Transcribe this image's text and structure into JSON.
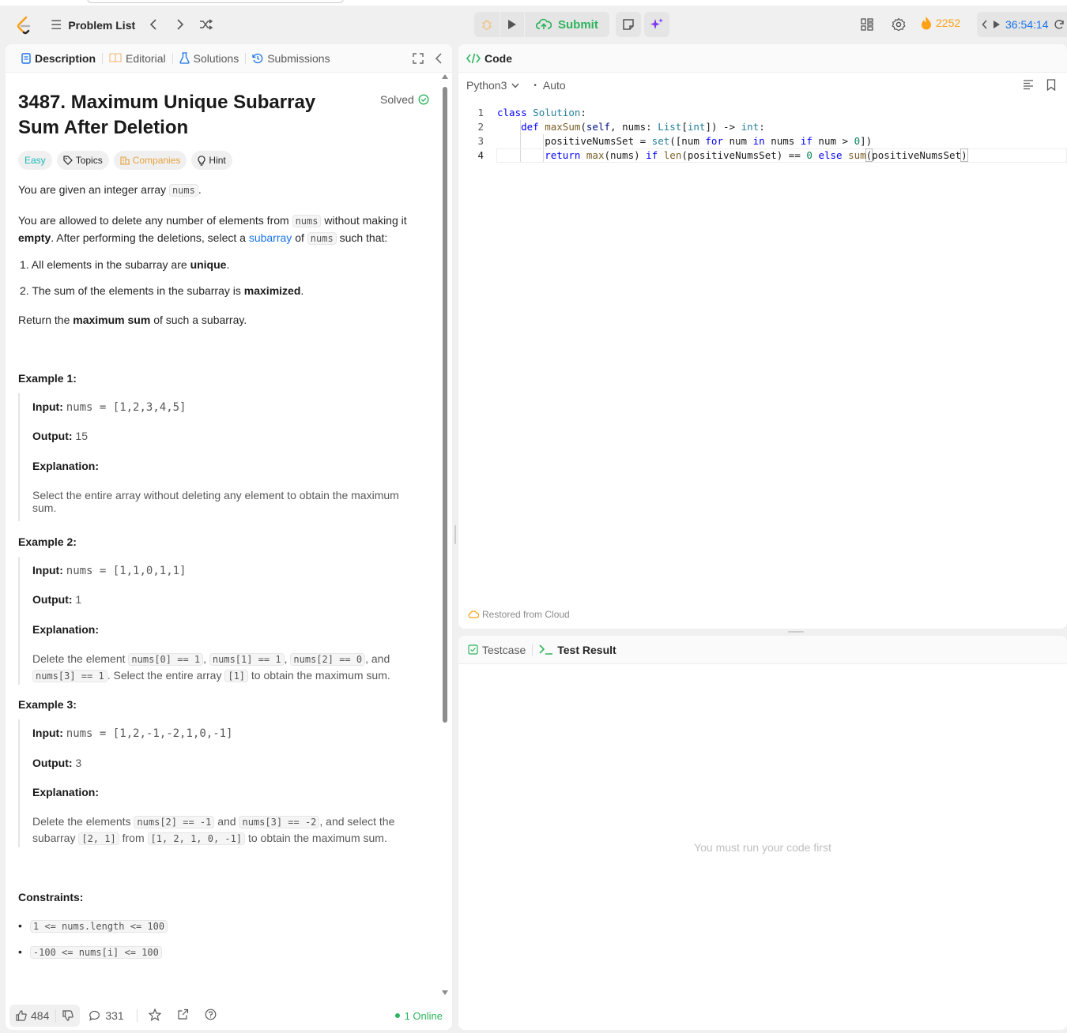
{
  "topbar": {
    "problem_list": "Problem List",
    "submit": "Submit",
    "streak": "2252",
    "timer": "36:54:14"
  },
  "left_tabs": {
    "description": "Description",
    "editorial": "Editorial",
    "solutions": "Solutions",
    "submissions": "Submissions"
  },
  "problem": {
    "title": "3487. Maximum Unique Subarray Sum After Deletion",
    "solved": "Solved",
    "difficulty": "Easy",
    "topics": "Topics",
    "companies": "Companies",
    "hint": "Hint",
    "p1_a": "You are given an integer array",
    "nums": "nums",
    "p2_a": "You are allowed to delete any number of elements from",
    "p2_b": "without making it",
    "p2_empty": "empty",
    "p2_c": ". After performing the deletions, select a",
    "p2_subarray": "subarray",
    "p2_d": "of",
    "p2_e": "such that:",
    "li1_a": "1. All elements in the subarray are",
    "li1_b": "unique",
    "li2_a": "2. The sum of the elements in the subarray is",
    "li2_b": "maximized",
    "ret_a": "Return the",
    "ret_b": "maximum sum",
    "ret_c": "of such a subarray."
  },
  "examples": [
    {
      "title": "Example 1:",
      "input": "nums = [1,2,3,4,5]",
      "output": "15",
      "explanation": "Select the entire array without deleting any element to obtain the maximum sum."
    },
    {
      "title": "Example 2:",
      "input": "nums = [1,1,0,1,1]",
      "output": "1",
      "e_a": "Delete the element",
      "c1": "nums[0] == 1",
      "c2": "nums[1] == 1",
      "c3": "nums[2] == 0",
      "e_and": ", and",
      "c4": "nums[3] == 1",
      "e_b": ". Select the entire array",
      "c5": "[1]",
      "e_c": "to obtain the maximum sum."
    },
    {
      "title": "Example 3:",
      "input": "nums = [1,2,-1,-2,1,0,-1]",
      "output": "3",
      "e_a": "Delete the elements",
      "c1": "nums[2] == -1",
      "e_and": "and",
      "c2": "nums[3] == -2",
      "e_b": ", and select the",
      "e_c": "subarray",
      "c3": "[2, 1]",
      "e_from": "from",
      "c4": "[1, 2, 1, 0, -1]",
      "e_d": "to obtain the maximum sum."
    }
  ],
  "labels": {
    "input": "Input:",
    "output": "Output:",
    "explanation": "Explanation:"
  },
  "constraints": {
    "title": "Constraints:",
    "c1": "1 <= nums.length <= 100",
    "c2": "-100 <= nums[i] <= 100"
  },
  "footer": {
    "likes": "484",
    "comments": "331",
    "online": "1 Online"
  },
  "code_panel": {
    "title": "Code",
    "language": "Python3",
    "auto": "Auto",
    "restored": "Restored from Cloud",
    "line_numbers": [
      "1",
      "2",
      "3",
      "4"
    ]
  },
  "result_panel": {
    "testcase": "Testcase",
    "test_result": "Test Result",
    "empty": "You must run your code first"
  }
}
